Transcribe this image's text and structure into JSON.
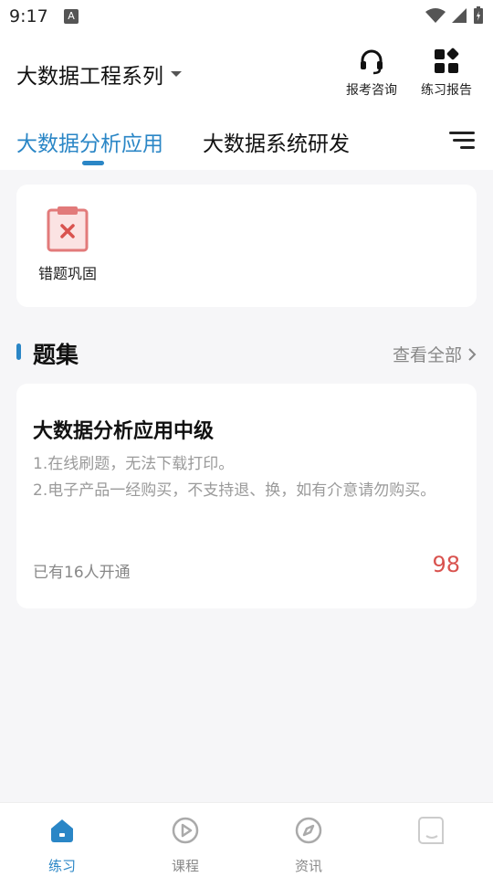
{
  "status": {
    "time": "9:17",
    "a_glyph": "A"
  },
  "header": {
    "series_title": "大数据工程系列",
    "actions": [
      {
        "label": "报考咨询",
        "icon": "headset-icon"
      },
      {
        "label": "练习报告",
        "icon": "grid-report-icon"
      }
    ]
  },
  "tabs": [
    {
      "label": "大数据分析应用",
      "active": true
    },
    {
      "label": "大数据系统研发",
      "active": false
    }
  ],
  "review": {
    "label": "错题巩固",
    "icon": "clipboard-x-icon"
  },
  "section": {
    "title": "题集",
    "view_all": "查看全部"
  },
  "question_set": {
    "title": "大数据分析应用中级",
    "desc1": "1.在线刷题，无法下载打印。",
    "desc2": "2.电子产品一经购买，不支持退、换，如有介意请勿购买。",
    "count": "已有16人开通",
    "price": "98"
  },
  "bottom_nav": [
    {
      "label": "练习",
      "icon": "home-icon",
      "active": true
    },
    {
      "label": "课程",
      "icon": "play-circle-icon",
      "active": false
    },
    {
      "label": "资讯",
      "icon": "compass-icon",
      "active": false
    },
    {
      "label": "",
      "icon": "profile-icon",
      "active": false
    }
  ],
  "colors": {
    "accent": "#2a86c6",
    "price": "#d9534f",
    "background": "#f6f6f8"
  }
}
